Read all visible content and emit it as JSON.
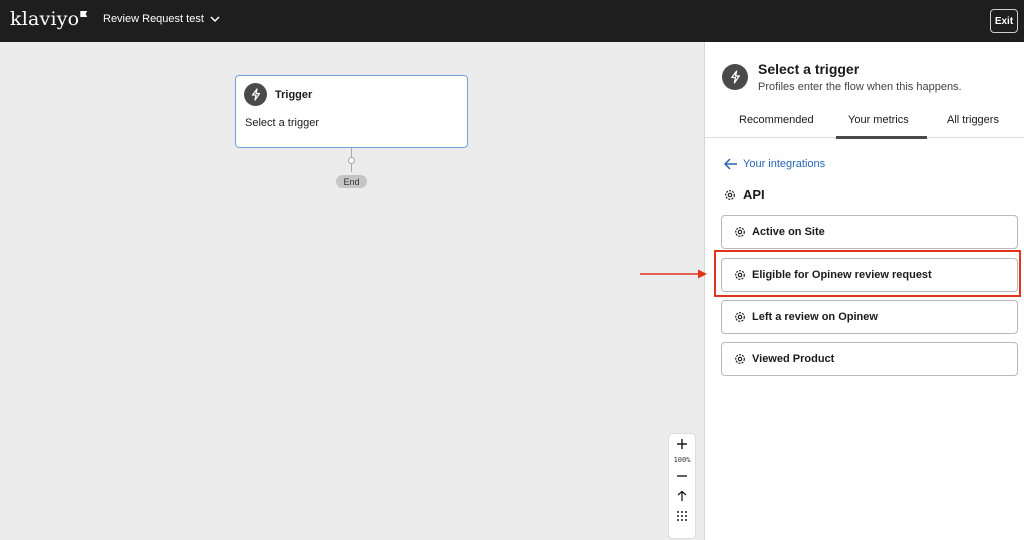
{
  "topbar": {
    "logo_text": "klaviyo",
    "flow_name": "Review Request test",
    "exit_label": "Exit"
  },
  "canvas": {
    "trigger_card": {
      "title": "Trigger",
      "subtitle": "Select a trigger"
    },
    "end_label": "End",
    "zoom_level": "100%"
  },
  "panel": {
    "title": "Select a trigger",
    "subtitle": "Profiles enter the flow when this happens.",
    "tabs": [
      {
        "label": "Recommended",
        "active": false
      },
      {
        "label": "Your metrics",
        "active": true
      },
      {
        "label": "All triggers",
        "active": false
      }
    ],
    "back_link": "Your integrations",
    "section_title": "API",
    "metrics": [
      {
        "label": "Active on Site"
      },
      {
        "label": "Eligible for Opinew review request",
        "highlighted": true
      },
      {
        "label": "Left a review on Opinew"
      },
      {
        "label": "Viewed Product"
      }
    ]
  },
  "colors": {
    "topbar": "#1e1e1e",
    "accent_link": "#2766b3",
    "highlight": "#e0341c",
    "card_border": "#6fa2d9"
  }
}
